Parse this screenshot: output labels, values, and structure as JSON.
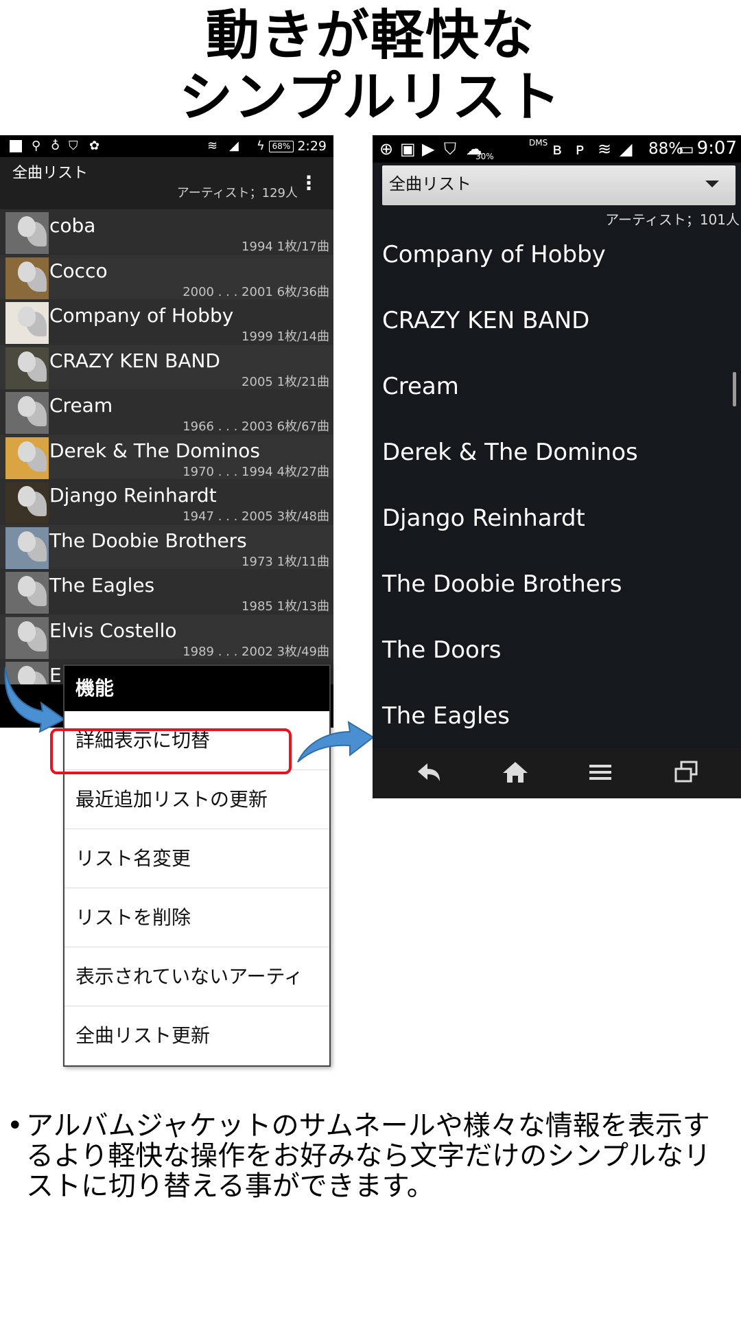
{
  "title": {
    "line1": "動きが軽快な",
    "line2": "シンプルリスト"
  },
  "left_phone": {
    "status": {
      "battery": "68%",
      "time": "2:29"
    },
    "header": {
      "title": "全曲リスト",
      "subtitle": "アーティスト；129人"
    },
    "rows": [
      {
        "name": "coba",
        "meta": "1994  1枚/17曲"
      },
      {
        "name": "Cocco",
        "meta": "2000 . . . 2001  6枚/36曲"
      },
      {
        "name": "Company of Hobby",
        "meta": "1999  1枚/14曲"
      },
      {
        "name": "CRAZY KEN BAND",
        "meta": "2005  1枚/21曲"
      },
      {
        "name": "Cream",
        "meta": "1966 . . . 2003  6枚/67曲"
      },
      {
        "name": "Derek & The Dominos",
        "meta": "1970 . . . 1994  4枚/27曲"
      },
      {
        "name": "Django Reinhardt",
        "meta": "1947 . . . 2005  3枚/48曲"
      },
      {
        "name": "The Doobie Brothers",
        "meta": "1973  1枚/11曲"
      },
      {
        "name": "The Eagles",
        "meta": "1985  1枚/13曲"
      },
      {
        "name": "Elvis Costello",
        "meta": "1989 . . . 2002  3枚/49曲"
      },
      {
        "name": "E",
        "meta": ""
      }
    ]
  },
  "context_menu": {
    "title": "機能",
    "items": [
      "詳細表示に切替",
      "最近追加リストの更新",
      "リスト名変更",
      "リストを削除",
      "表示されていないアーティ",
      "全曲リスト更新"
    ]
  },
  "right_phone": {
    "status": {
      "battery_pct": "88%",
      "time": "9:07",
      "weather_pct": "30%",
      "dms": "DMS"
    },
    "spinner": {
      "label": "全曲リスト"
    },
    "subtitle": "アーティスト；101人",
    "items": [
      "Company of Hobby",
      "CRAZY KEN BAND",
      "Cream",
      "Derek & The Dominos",
      "Django Reinhardt",
      "The Doobie Brothers",
      "The Doors",
      "The Eagles"
    ]
  },
  "description": {
    "bullet": "•",
    "text": "アルバムジャケットのサムネールや様々な情報を表示するより軽快な操作をお好みなら文字だけのシンプルなリストに切り替える事ができます。"
  },
  "colors": {
    "highlight": "#e8141d",
    "arrow": "#4a8fd1"
  }
}
